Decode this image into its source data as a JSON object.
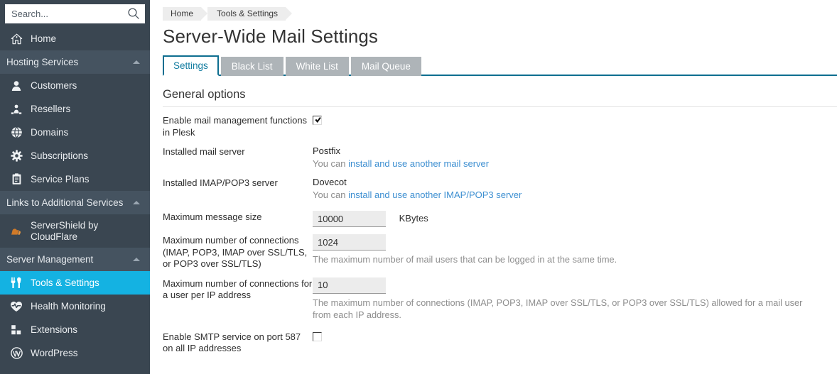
{
  "sidebar": {
    "search": {
      "placeholder": "Search...",
      "value": "",
      "icon": "search-icon"
    },
    "home": {
      "label": "Home",
      "icon": "home-icon"
    },
    "groups": [
      {
        "label": "Hosting Services",
        "caret_icon": "chevron-up-icon",
        "items": [
          {
            "label": "Customers",
            "icon": "user-icon"
          },
          {
            "label": "Resellers",
            "icon": "reseller-icon"
          },
          {
            "label": "Domains",
            "icon": "globe-icon"
          },
          {
            "label": "Subscriptions",
            "icon": "gear-icon"
          },
          {
            "label": "Service Plans",
            "icon": "clipboard-icon"
          }
        ]
      },
      {
        "label": "Links to Additional Services",
        "caret_icon": "chevron-up-icon",
        "items": [
          {
            "label": "ServerShield by CloudFlare",
            "icon": "cloudflare-icon"
          }
        ]
      },
      {
        "label": "Server Management",
        "caret_icon": "chevron-up-icon",
        "items": [
          {
            "label": "Tools & Settings",
            "icon": "tools-icon",
            "active": true
          },
          {
            "label": "Health Monitoring",
            "icon": "heart-pulse-icon"
          },
          {
            "label": "Extensions",
            "icon": "grid-icon"
          },
          {
            "label": "WordPress",
            "icon": "wordpress-icon"
          }
        ]
      }
    ]
  },
  "breadcrumb": [
    {
      "label": "Home"
    },
    {
      "label": "Tools & Settings"
    }
  ],
  "page": {
    "title": "Server-Wide Mail Settings"
  },
  "tabs": [
    {
      "label": "Settings",
      "active": true
    },
    {
      "label": "Black List",
      "active": false
    },
    {
      "label": "White List",
      "active": false
    },
    {
      "label": "Mail Queue",
      "active": false
    }
  ],
  "section": {
    "title": "General options"
  },
  "form": {
    "enable_mail_mgmt": {
      "label": "Enable mail management functions in Plesk",
      "checked": true
    },
    "installed_mail_server": {
      "label": "Installed mail server",
      "value": "Postfix",
      "hint_prefix": "You can ",
      "link": "install and use another mail server"
    },
    "installed_imap_pop3": {
      "label": "Installed IMAP/POP3 server",
      "value": "Dovecot",
      "hint_prefix": "You can ",
      "link": "install and use another IMAP/POP3 server"
    },
    "max_message_size": {
      "label": "Maximum message size",
      "value": "10000",
      "unit": "KBytes"
    },
    "max_connections": {
      "label": "Maximum number of connections (IMAP, POP3, IMAP over SSL/TLS, or POP3 over SSL/TLS)",
      "value": "1024",
      "hint": "The maximum number of mail users that can be logged in at the same time."
    },
    "max_connections_per_ip": {
      "label": "Maximum number of connections for a user per IP address",
      "value": "10",
      "hint": "The maximum number of connections (IMAP, POP3, IMAP over SSL/TLS, or POP3 over SSL/TLS) allowed for a mail user from each IP address."
    },
    "enable_smtp_587": {
      "label": "Enable SMTP service on port 587 on all IP addresses",
      "checked": false
    }
  },
  "colors": {
    "sidebar_bg": "#3a4651",
    "sidebar_group_bg": "#455360",
    "active_nav": "#14b2e2",
    "tab_active_border": "#0e6e90",
    "tab_inactive_bg": "#aeb4b8",
    "link": "#3d8fd1"
  }
}
